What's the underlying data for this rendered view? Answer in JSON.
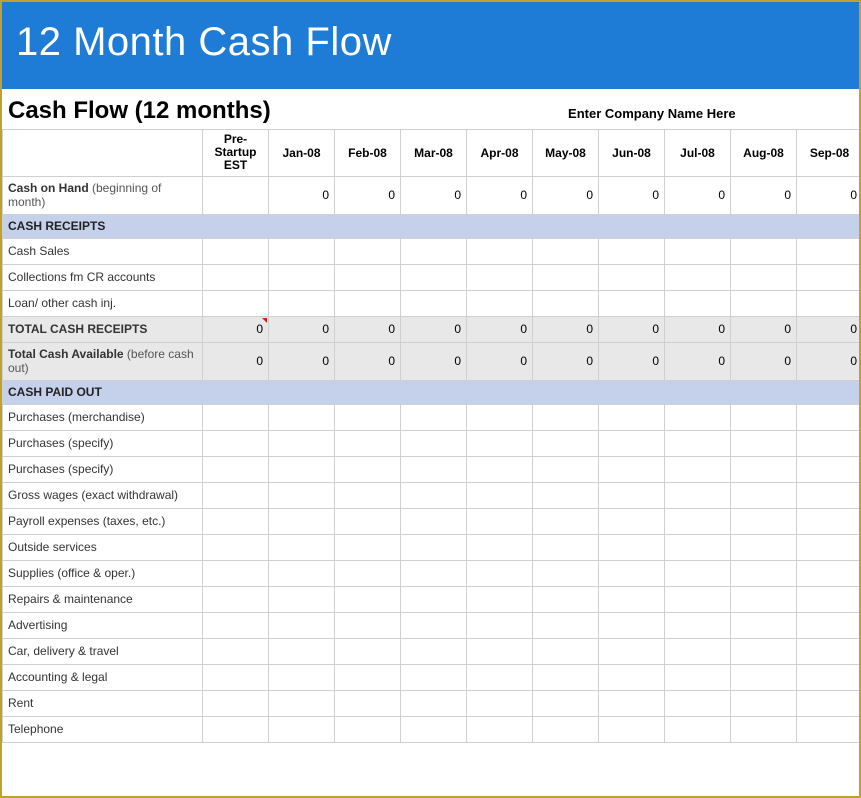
{
  "banner": "12 Month Cash Flow",
  "heading": "Cash Flow (12 months)",
  "company_placeholder": "Enter Company Name Here",
  "columns": {
    "pre_startup": "Pre-Startup EST",
    "months": [
      "Jan-08",
      "Feb-08",
      "Mar-08",
      "Apr-08",
      "May-08",
      "Jun-08",
      "Jul-08",
      "Aug-08",
      "Sep-08"
    ]
  },
  "rows": {
    "cash_on_hand": {
      "label_bold": "Cash on Hand",
      "label_light": " (beginning of month)",
      "values": [
        "",
        "0",
        "0",
        "0",
        "0",
        "0",
        "0",
        "0",
        "0",
        "0"
      ]
    },
    "section_receipts": "CASH RECEIPTS",
    "cash_sales": {
      "label": "Cash Sales"
    },
    "collections": {
      "label": "Collections fm CR accounts"
    },
    "loan_other": {
      "label": "Loan/ other cash inj."
    },
    "total_receipts": {
      "label": "TOTAL CASH RECEIPTS",
      "values": [
        "0",
        "0",
        "0",
        "0",
        "0",
        "0",
        "0",
        "0",
        "0",
        "0"
      ]
    },
    "total_avail": {
      "label_bold": "Total Cash Available",
      "label_light": " (before cash out)",
      "values": [
        "0",
        "0",
        "0",
        "0",
        "0",
        "0",
        "0",
        "0",
        "0",
        "0"
      ]
    },
    "section_paid": "CASH PAID OUT",
    "purchases_merch": {
      "label": "Purchases (merchandise)"
    },
    "purchases_spec1": {
      "label": "Purchases (specify)"
    },
    "purchases_spec2": {
      "label": "Purchases (specify)"
    },
    "gross_wages": {
      "label": "Gross wages (exact withdrawal)"
    },
    "payroll_exp": {
      "label": "Payroll expenses (taxes, etc.)"
    },
    "outside_services": {
      "label": "Outside services"
    },
    "supplies": {
      "label": "Supplies (office & oper.)"
    },
    "repairs": {
      "label": "Repairs & maintenance"
    },
    "advertising": {
      "label": "Advertising"
    },
    "car_delivery": {
      "label": "Car, delivery & travel"
    },
    "acct_legal": {
      "label": "Accounting & legal"
    },
    "rent": {
      "label": "Rent"
    },
    "telephone": {
      "label": "Telephone"
    }
  }
}
